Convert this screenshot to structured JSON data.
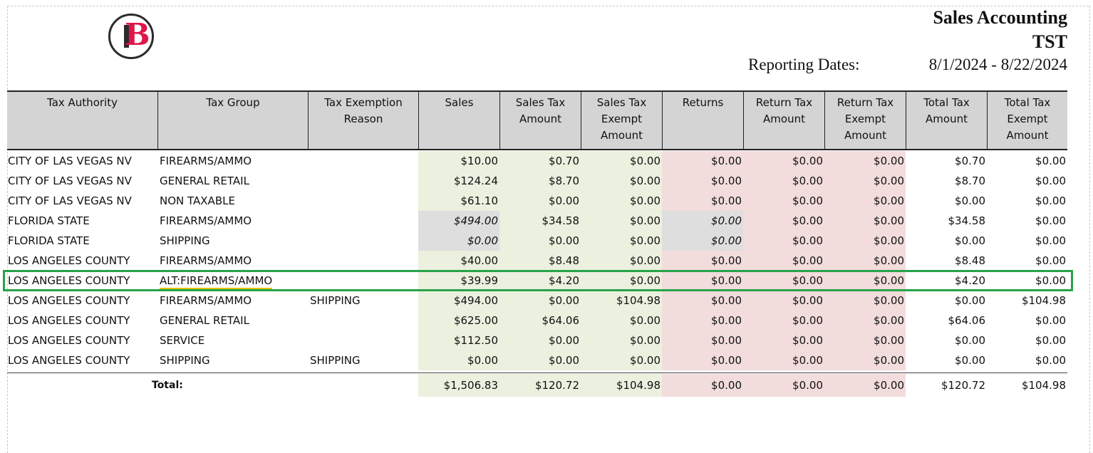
{
  "report": {
    "title": "Sales Accounting",
    "subtitle": "TST",
    "dates_label": "Reporting Dates:",
    "dates_value": "8/1/2024 - 8/22/2024"
  },
  "logo": {
    "letter": "B",
    "accent_color": "#e0164b"
  },
  "columns": [
    "Tax Authority",
    "Tax Group",
    "Tax Exemption\nReason",
    "Sales",
    "Sales Tax\nAmount",
    "Sales Tax\nExempt\nAmount",
    "Returns",
    "Return Tax\nAmount",
    "Return Tax\nExempt\nAmount",
    "Total Tax\nAmount",
    "Total Tax\nExempt\nAmount"
  ],
  "rows": [
    [
      "CITY OF LAS VEGAS NV",
      "FIREARMS/AMMO",
      "",
      "$10.00",
      "$0.70",
      "$0.00",
      "$0.00",
      "$0.00",
      "$0.00",
      "$0.70",
      "$0.00"
    ],
    [
      "CITY OF LAS VEGAS NV",
      "GENERAL RETAIL",
      "",
      "$124.24",
      "$8.70",
      "$0.00",
      "$0.00",
      "$0.00",
      "$0.00",
      "$8.70",
      "$0.00"
    ],
    [
      "CITY OF LAS VEGAS NV",
      "NON TAXABLE",
      "",
      "$61.10",
      "$0.00",
      "$0.00",
      "$0.00",
      "$0.00",
      "$0.00",
      "$0.00",
      "$0.00"
    ],
    [
      "FLORIDA STATE",
      "FIREARMS/AMMO",
      "",
      "$494.00",
      "$34.58",
      "$0.00",
      "$0.00",
      "$0.00",
      "$0.00",
      "$34.58",
      "$0.00"
    ],
    [
      "FLORIDA STATE",
      "SHIPPING",
      "",
      "$0.00",
      "$0.00",
      "$0.00",
      "$0.00",
      "$0.00",
      "$0.00",
      "$0.00",
      "$0.00"
    ],
    [
      "LOS ANGELES COUNTY",
      "FIREARMS/AMMO",
      "",
      "$40.00",
      "$8.48",
      "$0.00",
      "$0.00",
      "$0.00",
      "$0.00",
      "$8.48",
      "$0.00"
    ],
    [
      "LOS ANGELES COUNTY",
      "ALT:FIREARMS/AMMO",
      "",
      "$39.99",
      "$4.20",
      "$0.00",
      "$0.00",
      "$0.00",
      "$0.00",
      "$4.20",
      "$0.00"
    ],
    [
      "LOS ANGELES COUNTY",
      "FIREARMS/AMMO",
      "SHIPPING",
      "$494.00",
      "$0.00",
      "$104.98",
      "$0.00",
      "$0.00",
      "$0.00",
      "$0.00",
      "$104.98"
    ],
    [
      "LOS ANGELES COUNTY",
      "GENERAL RETAIL",
      "",
      "$625.00",
      "$64.06",
      "$0.00",
      "$0.00",
      "$0.00",
      "$0.00",
      "$64.06",
      "$0.00"
    ],
    [
      "LOS ANGELES COUNTY",
      "SERVICE",
      "",
      "$112.50",
      "$0.00",
      "$0.00",
      "$0.00",
      "$0.00",
      "$0.00",
      "$0.00",
      "$0.00"
    ],
    [
      "LOS ANGELES COUNTY",
      "SHIPPING",
      "SHIPPING",
      "$0.00",
      "$0.00",
      "$0.00",
      "$0.00",
      "$0.00",
      "$0.00",
      "$0.00",
      "$0.00"
    ]
  ],
  "italic_gray_rows": [
    3,
    4
  ],
  "highlighted_row": 6,
  "totals": {
    "label": "Total:",
    "values": [
      "$1,506.83",
      "$120.72",
      "$104.98",
      "$0.00",
      "$0.00",
      "$0.00",
      "$120.72",
      "$104.98"
    ]
  },
  "colors": {
    "sales_bg": "#ebf0df",
    "returns_bg": "#f2dcdc",
    "gray_bg": "#dedede",
    "highlight_border": "#27a349",
    "underline": "#e0c400"
  }
}
